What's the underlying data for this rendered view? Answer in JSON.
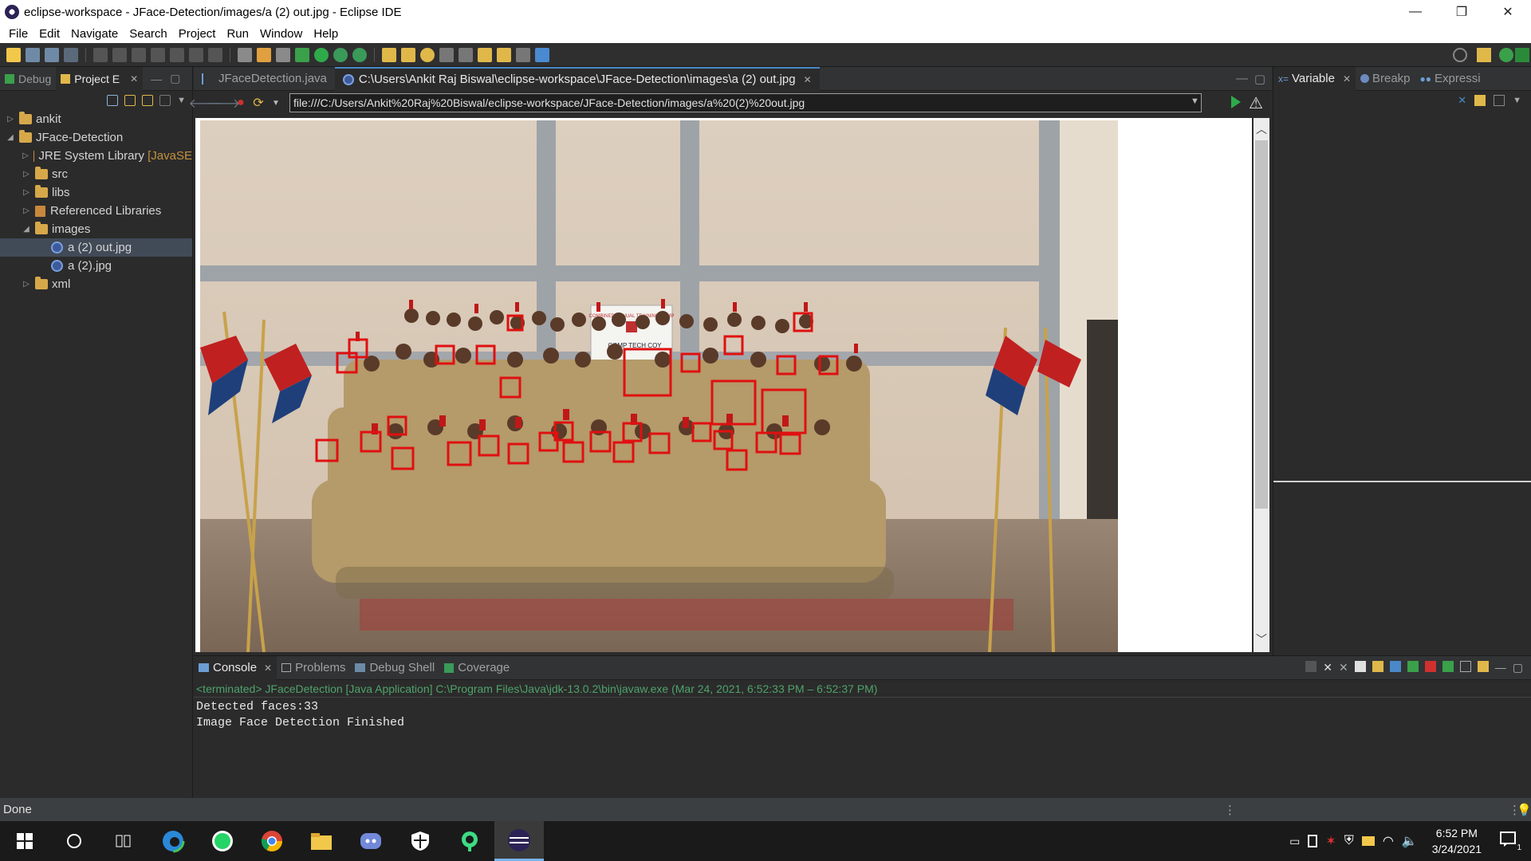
{
  "window": {
    "title": "eclipse-workspace - JFace-Detection/images/a (2) out.jpg - Eclipse IDE",
    "controls": [
      "—",
      "❐",
      "✕"
    ]
  },
  "menu": [
    "File",
    "Edit",
    "Navigate",
    "Search",
    "Project",
    "Run",
    "Window",
    "Help"
  ],
  "left_panel": {
    "tabs": [
      {
        "label": "Debug",
        "active": false
      },
      {
        "label": "Project E",
        "active": true
      }
    ],
    "tree": [
      {
        "label": "ankit",
        "level": 0,
        "expanded": false,
        "icon": "project-folder-icon"
      },
      {
        "label": "JFace-Detection",
        "level": 0,
        "expanded": true,
        "icon": "project-folder-icon"
      },
      {
        "label": "JRE System Library",
        "suffix": "[JavaSE",
        "level": 1,
        "expanded": false,
        "icon": "library-icon"
      },
      {
        "label": "src",
        "level": 1,
        "expanded": false,
        "icon": "source-folder-icon"
      },
      {
        "label": "libs",
        "level": 1,
        "expanded": false,
        "icon": "folder-icon"
      },
      {
        "label": "Referenced Libraries",
        "level": 1,
        "expanded": false,
        "icon": "library-icon"
      },
      {
        "label": "images",
        "level": 1,
        "expanded": true,
        "icon": "folder-icon"
      },
      {
        "label": "a (2) out.jpg",
        "level": 2,
        "selected": true,
        "icon": "image-file-icon"
      },
      {
        "label": "a (2).jpg",
        "level": 2,
        "icon": "image-file-icon"
      },
      {
        "label": "xml",
        "level": 1,
        "expanded": false,
        "icon": "folder-icon"
      }
    ]
  },
  "editor": {
    "tabs": [
      {
        "label": "JFaceDetection.java",
        "active": false,
        "icon": "java-file-icon"
      },
      {
        "label": "C:\\Users\\Ankit Raj Biswal\\eclipse-workspace\\JFace-Detection\\images\\a (2) out.jpg",
        "active": true,
        "icon": "browser-icon"
      }
    ],
    "url": "file:///C:/Users/Ankit%20Raj%20Biswal/eclipse-workspace/JFace-Detection/images/a%20(2)%20out.jpg",
    "photo_sign": {
      "line1": "COMBINED ANNUAL TRAINING CAMP",
      "line2": "COMP TECH COY"
    }
  },
  "right_panel": {
    "tabs": [
      {
        "label": "Variable",
        "active": true
      },
      {
        "label": "Breakp",
        "active": false
      },
      {
        "label": "Expressi",
        "active": false
      }
    ]
  },
  "console": {
    "tabs": [
      {
        "label": "Console",
        "active": true
      },
      {
        "label": "Problems",
        "active": false
      },
      {
        "label": "Debug Shell",
        "active": false
      },
      {
        "label": "Coverage",
        "active": false
      }
    ],
    "header": "<terminated> JFaceDetection [Java Application] C:\\Program Files\\Java\\jdk-13.0.2\\bin\\javaw.exe  (Mar 24, 2021, 6:52:33 PM – 6:52:37 PM)",
    "lines": [
      "Detected faces:33",
      "Image Face Detection Finished"
    ]
  },
  "status": {
    "text": "Done"
  },
  "taskbar": {
    "time": "6:52 PM",
    "date": "3/24/2021",
    "notification_count": "1"
  },
  "colors": {
    "accent": "#4a88c7",
    "detection_box": "#e01010",
    "console_header": "#4fa36b"
  }
}
